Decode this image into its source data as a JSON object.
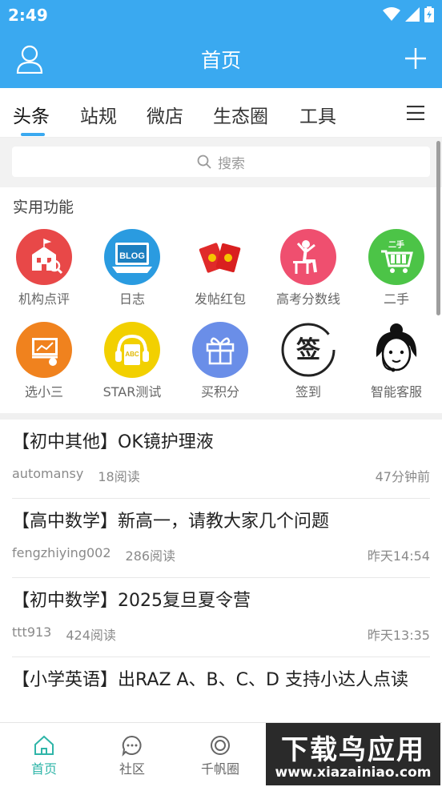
{
  "status": {
    "time": "2:49"
  },
  "appbar": {
    "title": "首页"
  },
  "tabs": [
    {
      "label": "头条"
    },
    {
      "label": "站规"
    },
    {
      "label": "微店"
    },
    {
      "label": "生态圈"
    },
    {
      "label": "工具"
    }
  ],
  "search": {
    "placeholder": "搜索"
  },
  "functions": {
    "title": "实用功能",
    "items": [
      {
        "label": "机构点评",
        "icon": "school-review-icon",
        "color": "#e84848"
      },
      {
        "label": "日志",
        "icon": "blog-icon",
        "color": "#2a9be0"
      },
      {
        "label": "发帖红包",
        "icon": "red-envelope-icon",
        "color": "#ffffff"
      },
      {
        "label": "高考分数线",
        "icon": "exam-desk-icon",
        "color": "#ef4f6f"
      },
      {
        "label": "二手",
        "icon": "second-hand-cart-icon",
        "color": "#4cc447"
      },
      {
        "label": "选小三",
        "icon": "classroom-icon",
        "color": "#f0821e"
      },
      {
        "label": "STAR测试",
        "icon": "abc-headphones-icon",
        "color": "#f2d000"
      },
      {
        "label": "买积分",
        "icon": "gift-icon",
        "color": "#6a8ee8"
      },
      {
        "label": "签到",
        "icon": "sign-in-icon",
        "color": "#ffffff"
      },
      {
        "label": "智能客服",
        "icon": "customer-service-icon",
        "color": "#ffffff"
      }
    ]
  },
  "posts": [
    {
      "title": "【初中其他】OK镜护理液",
      "author": "automansy",
      "reads": "18阅读",
      "time": "47分钟前"
    },
    {
      "title": "【高中数学】新高一，请教大家几个问题",
      "author": "fengzhiying002",
      "reads": "286阅读",
      "time": "昨天14:54"
    },
    {
      "title": "【初中数学】2025复旦夏令营",
      "author": "ttt913",
      "reads": "424阅读",
      "time": "昨天13:35"
    },
    {
      "title": "【小学英语】出RAZ A、B、C、D 支持小达人点读",
      "author": "",
      "reads": "",
      "time": ""
    }
  ],
  "bottom_nav": [
    {
      "label": "首页",
      "icon": "home-icon"
    },
    {
      "label": "社区",
      "icon": "chat-bubble-icon"
    },
    {
      "label": "千帆圈",
      "icon": "circle-icon"
    }
  ],
  "watermark": {
    "text": "下载鸟应用",
    "url": "www.xiazainiao.com"
  },
  "colors": {
    "accent": "#3aa9f0",
    "nav_active": "#2fb5a8"
  }
}
